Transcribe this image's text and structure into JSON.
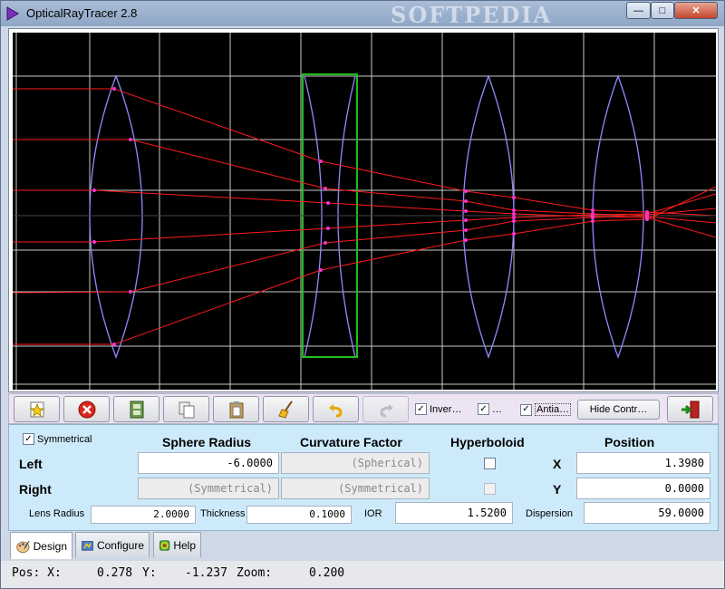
{
  "window": {
    "title": "OpticalRayTracer 2.8",
    "watermark": "SOFTPEDIA",
    "buttons": {
      "minimize": "—",
      "maximize": "□",
      "close": "✕"
    }
  },
  "canvas": {
    "background": "#000000",
    "grid_color": "#c8c8c8",
    "lens_color": "#8c8cff",
    "ray_color": "#ff1a1a",
    "selected_color": "#22bb22"
  },
  "toolbar": {
    "buttons": [
      {
        "name": "new-lens-button",
        "icon": "star-icon"
      },
      {
        "name": "delete-button",
        "icon": "close-icon"
      },
      {
        "name": "film-button",
        "icon": "film-icon"
      },
      {
        "name": "copy-button",
        "icon": "copy-icon"
      },
      {
        "name": "paste-button",
        "icon": "paste-icon"
      },
      {
        "name": "clean-button",
        "icon": "broom-icon"
      },
      {
        "name": "undo-button",
        "icon": "undo-icon"
      },
      {
        "name": "redo-button",
        "icon": "redo-icon"
      }
    ],
    "checks": [
      {
        "label": "Inver…",
        "checked": true
      },
      {
        "label": "…",
        "checked": true
      },
      {
        "label": "Antia…",
        "checked": true
      }
    ],
    "hide_label": "Hide Contr…"
  },
  "props": {
    "symmetrical_label": "Symmetrical",
    "symmetrical_checked": true,
    "headers": {
      "sphere_radius": "Sphere Radius",
      "curvature_factor": "Curvature Factor",
      "hyperboloid": "Hyperboloid",
      "position": "Position"
    },
    "left": {
      "label": "Left",
      "sphere_radius": "-6.0000",
      "curvature_factor": "(Spherical)",
      "pos_axis": "X",
      "position": "1.3980"
    },
    "right": {
      "label": "Right",
      "sphere_radius": "(Symmetrical)",
      "curvature_factor": "(Symmetrical)",
      "pos_axis": "Y",
      "position": "0.0000"
    },
    "lens_radius_label": "Lens Radius",
    "lens_radius": "2.0000",
    "thickness_label": "Thickness",
    "thickness": "0.1000",
    "ior_label": "IOR",
    "ior": "1.5200",
    "dispersion_label": "Dispersion",
    "dispersion": "59.0000"
  },
  "tabs": [
    {
      "label": "Design",
      "icon": "design-icon",
      "active": true
    },
    {
      "label": "Configure",
      "icon": "configure-icon",
      "active": false
    },
    {
      "label": "Help",
      "icon": "help-icon",
      "active": false
    }
  ],
  "status": {
    "pos_label": "Pos: X:",
    "x": "0.278",
    "y_label": "Y:",
    "y": "-1.237",
    "zoom_label": "Zoom:",
    "zoom": "0.200"
  }
}
